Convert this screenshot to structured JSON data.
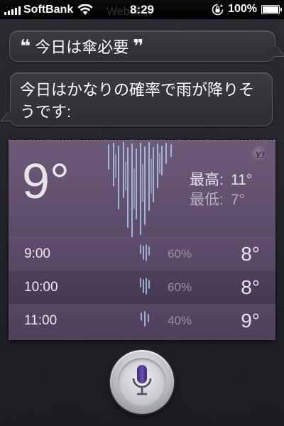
{
  "status_bar": {
    "carrier": "SoftBank",
    "time": "8:29",
    "battery": "100%",
    "battery_level": 1.0,
    "icons": [
      "signal-bars-icon",
      "wifi-icon",
      "rotation-lock-icon",
      "battery-icon"
    ],
    "behind_text": "Web検索"
  },
  "conversation": {
    "user_query": "今日は傘必要",
    "open_quote": "❝",
    "close_quote": "❞",
    "siri_response": "今日はかなりの確率で雨が降りそうです:"
  },
  "weather": {
    "current_temp": "9°",
    "high_label": "最高:",
    "high_temp": "11°",
    "low_label": "最低:",
    "low_temp": "7°",
    "provider_badge": "Y!",
    "hourly": [
      {
        "time": "9:00",
        "precip": "60%",
        "temp": "8°"
      },
      {
        "time": "10:00",
        "precip": "60%",
        "temp": "8°"
      },
      {
        "time": "11:00",
        "precip": "40%",
        "temp": "9°"
      }
    ],
    "colors": {
      "card": "#5d4c69",
      "rain": "#9fc2ea"
    }
  },
  "siri_mic": {
    "icon": "microphone-icon",
    "accent": "#5a3f9a"
  }
}
